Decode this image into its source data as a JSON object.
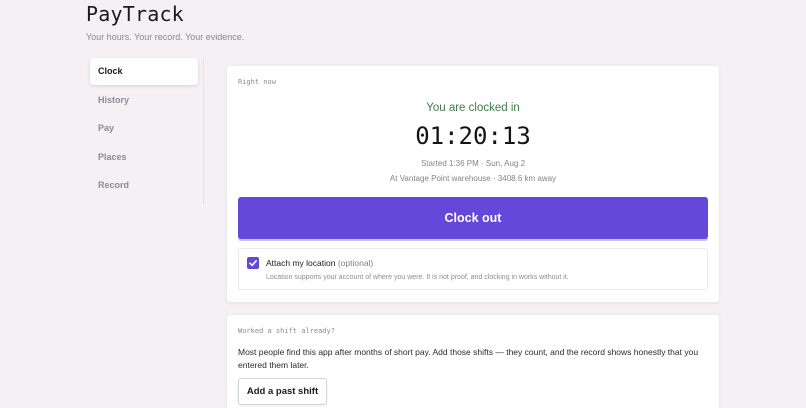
{
  "app": {
    "title": "PayTrack",
    "tagline": "Your hours. Your record. Your evidence."
  },
  "nav": {
    "items": [
      {
        "label": "Clock",
        "active": true
      },
      {
        "label": "History",
        "active": false
      },
      {
        "label": "Pay",
        "active": false
      },
      {
        "label": "Places",
        "active": false
      },
      {
        "label": "Record",
        "active": false
      }
    ]
  },
  "now": {
    "section_label": "Right now",
    "status": "You are clocked in",
    "timer": "01:20:13",
    "started": "Started 1:36 PM · Sun, Aug 2",
    "location": "At Vantage Point warehouse · 3408.6 km away",
    "clock_out_label": "Clock out",
    "attach": {
      "checked": true,
      "label": "Attach my location",
      "optional": "(optional)",
      "note": "Location supports your account of where you were. It is not proof, and clocking in works without it."
    }
  },
  "past": {
    "section_label": "Worked a shift already?",
    "description": "Most people find this app after months of short pay. Add those shifts — they count, and the record shows honestly that you entered them later.",
    "button_label": "Add a past shift"
  },
  "colors": {
    "accent": "#6448d9",
    "status_green": "#3e7d45",
    "background": "#f4f0f4"
  }
}
